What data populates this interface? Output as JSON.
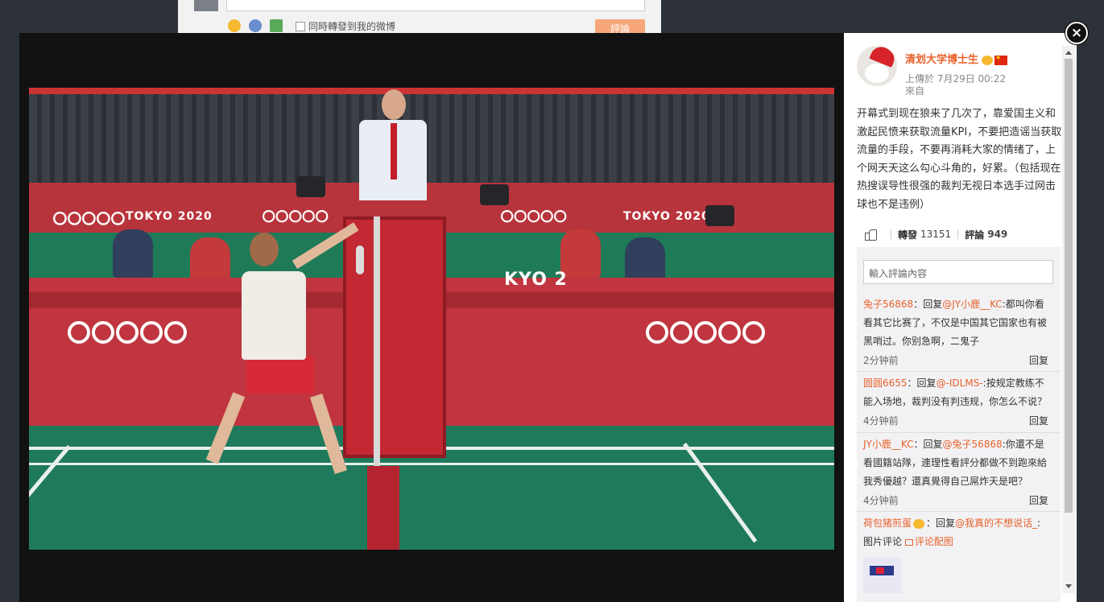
{
  "background_page": {
    "repost_checkbox_label": "同時轉發到我的微博",
    "submit_label": "評論"
  },
  "post": {
    "author_name": "清划大学博士生",
    "uploaded_time": "上傳於 7月29日 00:22",
    "source": "來自",
    "text": "开幕式到现在狼来了几次了，靠爱国主义和激起民愤来获取流量KPI，不要把造谣当获取流量的手段，不要再消耗大家的情绪了，上个网天天这么勾心斗角的，好累。（包括现在热搜误导性很强的裁判无视日本选手过网击球也不是违例）",
    "repost_label": "轉發",
    "repost_count": "13151",
    "comment_label": "評論",
    "comment_count": "949"
  },
  "comments": {
    "input_placeholder": "輸入評論內容",
    "items": [
      {
        "user": "兔子56868",
        "sep": "：回复",
        "mention": "@JY小鹿__KC",
        "text": ":都叫你看看其它比赛了，不仅是中国其它国家也有被黑哨过。你别急啊，二鬼子",
        "time": "2分钟前",
        "reply": "回复"
      },
      {
        "user": "圆圆6655",
        "sep": "：回复",
        "mention": "@-IDLMS-",
        "text": ":按规定教练不能入场地，裁判没有判违规，你怎么不说？",
        "time": "4分钟前",
        "reply": "回复"
      },
      {
        "user": "JY小鹿__KC",
        "sep": "：回复",
        "mention": "@兔子56868",
        "text": ":你還不是看國籍站隊，連理性看評分都做不到跑來給我秀優越？還真覺得自己屌炸天是吧？",
        "time": "4分钟前",
        "reply": "回复"
      },
      {
        "user": "荷包猪煎蛋",
        "sep": "：回复",
        "mention": "@我真的不想说话_",
        "text": ":图片评论",
        "link": "评论配图"
      }
    ]
  },
  "close_label": "×",
  "scene_text": {
    "tokyo_left": "TOKYO 2020",
    "tokyo_right": "TOKYO 2020",
    "tokyo_center": "KYO 2"
  },
  "colors": {
    "accent": "#e8612a",
    "overlay": "#111111"
  }
}
